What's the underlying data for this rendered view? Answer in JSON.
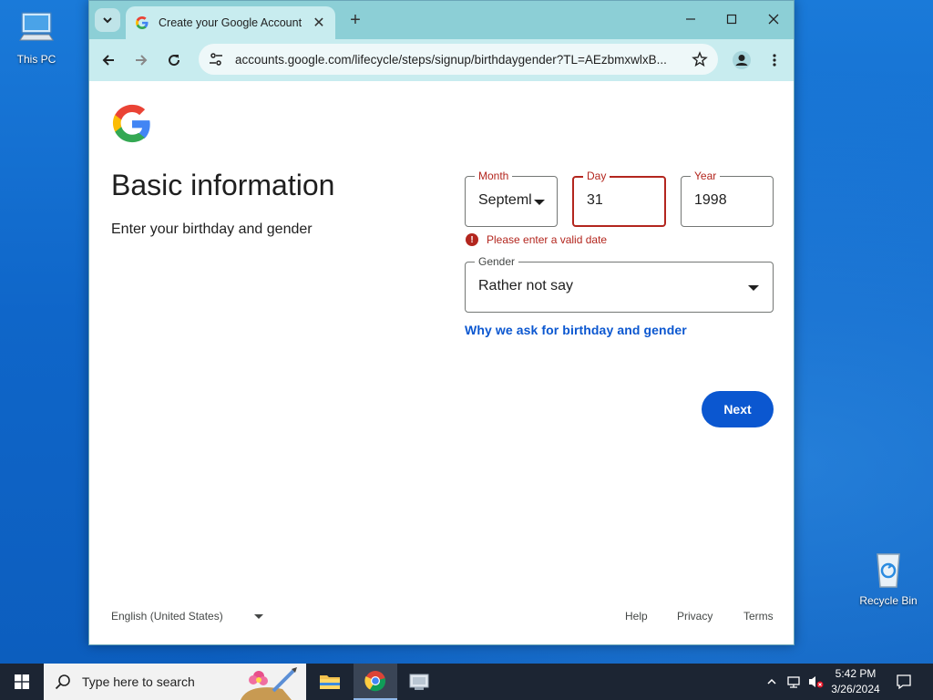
{
  "desktop": {
    "icons": [
      {
        "label": "This PC"
      },
      {
        "label": "Recycle Bin"
      }
    ]
  },
  "browser": {
    "tab": {
      "title": "Create your Google Account"
    },
    "address": {
      "url": "accounts.google.com/lifecycle/steps/signup/birthdaygender?TL=AEzbmxwlxB..."
    }
  },
  "page": {
    "title": "Basic information",
    "subtitle": "Enter your birthday and gender",
    "month": {
      "label": "Month",
      "value": "Septeml"
    },
    "day": {
      "label": "Day",
      "value": "31"
    },
    "year": {
      "label": "Year",
      "value": "1998"
    },
    "error": "Please enter a valid date",
    "gender": {
      "label": "Gender",
      "value": "Rather not say"
    },
    "why_link": "Why we ask for birthday and gender",
    "next_label": "Next",
    "footer": {
      "language": "English (United States)",
      "help": "Help",
      "privacy": "Privacy",
      "terms": "Terms"
    }
  },
  "taskbar": {
    "search_placeholder": "Type here to search",
    "time": "5:42 PM",
    "date": "3/26/2024"
  },
  "colors": {
    "accent": "#0b57d0",
    "error": "#b3261e",
    "tab_bar": "#8ccfd6",
    "toolbar": "#c8ecef"
  }
}
